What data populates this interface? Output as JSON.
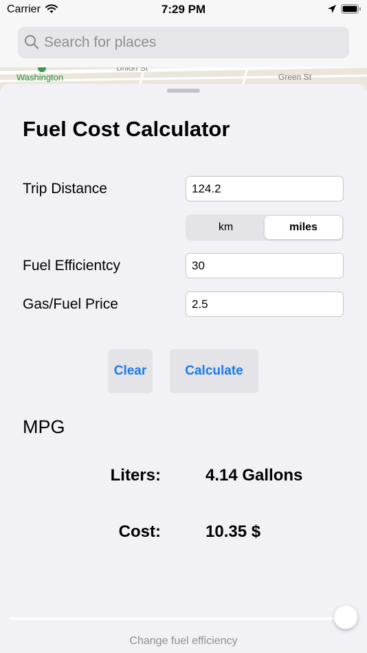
{
  "status_bar": {
    "carrier": "Carrier",
    "time": "7:29 PM"
  },
  "search": {
    "placeholder": "Search for places"
  },
  "map": {
    "labels": [
      "Washington",
      "Union St",
      "Green St"
    ]
  },
  "calculator": {
    "title": "Fuel Cost Calculator",
    "trip_distance_label": "Trip Distance",
    "trip_distance_value": "124.2",
    "unit_options": [
      "km",
      "miles"
    ],
    "selected_unit": "miles",
    "fuel_efficiency_label": "Fuel Efficientcy",
    "fuel_efficiency_value": "30",
    "price_label": "Gas/Fuel Price",
    "price_value": "2.5",
    "clear_label": "Clear",
    "calculate_label": "Calculate",
    "efficiency_unit": "MPG",
    "liters_label": "Liters:",
    "liters_value": "4.14 Gallons",
    "cost_label": "Cost:",
    "cost_value": "10.35 $",
    "slider_caption": "Change fuel efficiency",
    "slider_level": 1.0
  },
  "colors": {
    "accent": "#1a7ce8",
    "background": "#f2f1f6",
    "map_green": "#2e8b3a"
  }
}
